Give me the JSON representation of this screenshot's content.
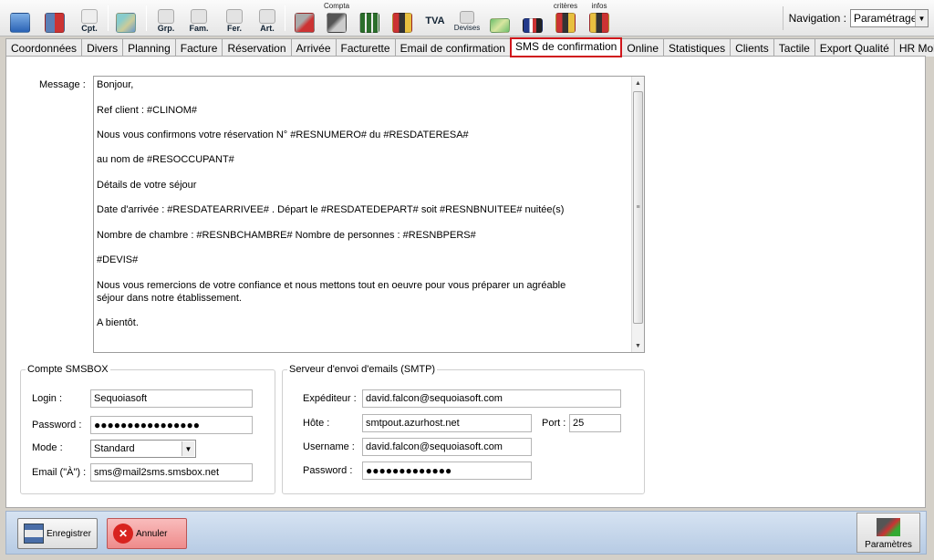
{
  "toolbar": {
    "buttons": [
      {
        "icon": "home-icon",
        "label": "",
        "top": ""
      },
      {
        "icon": "building-icon",
        "label": "",
        "top": ""
      },
      {
        "icon": "accounting-icon",
        "label": "Cpt.",
        "top": ""
      },
      {
        "icon": "cards-icon",
        "label": "",
        "top": ""
      },
      {
        "icon": "group-icon",
        "label": "Grp.",
        "top": ""
      },
      {
        "icon": "family-icon",
        "label": "Fam.",
        "top": ""
      },
      {
        "icon": "closure-icon",
        "label": "Fer.",
        "top": ""
      },
      {
        "icon": "article-icon",
        "label": "Art.",
        "top": ""
      },
      {
        "icon": "tools-icon",
        "label": "",
        "top": ""
      },
      {
        "icon": "accounting-tools-icon",
        "label": "",
        "top": "Compta"
      },
      {
        "icon": "floorplan-icon",
        "label": "",
        "top": ""
      },
      {
        "icon": "people-icon",
        "label": "",
        "top": ""
      },
      {
        "icon": "tax-icon",
        "label": "TVA",
        "top": ""
      },
      {
        "icon": "currency-icon",
        "label": "Devises",
        "top": ""
      },
      {
        "icon": "map-icon",
        "label": "",
        "top": ""
      },
      {
        "icon": "flags-icon",
        "label": "",
        "top": ""
      },
      {
        "icon": "criteria-icon",
        "label": "",
        "top": "critères"
      },
      {
        "icon": "info-icon",
        "label": "",
        "top": "infos"
      }
    ],
    "navigation_label": "Navigation :",
    "navigation_value": "Paramétrage"
  },
  "tabs": [
    "Coordonnées",
    "Divers",
    "Planning",
    "Facture",
    "Réservation",
    "Arrivée",
    "Facturette",
    "Email de confirmation",
    "SMS de confirmation",
    "Online",
    "Statistiques",
    "Clients",
    "Tactile",
    "Export Qualité",
    "HR Mobile"
  ],
  "active_tab": "SMS de confirmation",
  "message": {
    "label": "Message :",
    "lines": [
      "Bonjour,",
      "Ref client :  #CLINOM#",
      "Nous vous confirmons votre réservation N° #RESNUMERO# du #RESDATERESA#",
      "au nom de #RESOCCUPANT#",
      "Détails de votre séjour",
      "Date d'arrivée :  #RESDATEARRIVEE# . Départ le  #RESDATEDEPART# soit  #RESNBNUITEE# nuitée(s)",
      "Nombre de chambre :  #RESNBCHAMBRE#    Nombre de personnes : #RESNBPERS#",
      "#DEVIS#",
      "Nous vous remercions de votre confiance et nous mettons tout en oeuvre pour vous préparer un agréable",
      "séjour dans notre établissement.",
      "A bientôt."
    ]
  },
  "smsbox": {
    "title": "Compte SMSBOX",
    "login_label": "Login :",
    "login_value": "Sequoiasoft",
    "password_label": "Password :",
    "password_value": "●●●●●●●●●●●●●●●●",
    "mode_label": "Mode :",
    "mode_value": "Standard",
    "email_label": "Email (\"À\") :",
    "email_value": "sms@mail2sms.smsbox.net"
  },
  "smtp": {
    "title": "Serveur d'envoi d'emails (SMTP)",
    "sender_label": "Expéditeur :",
    "sender_value": "david.falcon@sequoiasoft.com",
    "host_label": "Hôte :",
    "host_value": "smtpout.azurhost.net",
    "port_label": "Port :",
    "port_value": "25",
    "username_label": "Username :",
    "username_value": "david.falcon@sequoiasoft.com",
    "password_label": "Password :",
    "password_value": "●●●●●●●●●●●●●"
  },
  "actions": {
    "save_label": "Enregistrer",
    "cancel_label": "Annuler",
    "params_label": "Paramètres"
  },
  "colors": {
    "active_tab_border": "#d0161b",
    "cancel_button": "#f5a0a0",
    "bottom_bar": "#c4d5ea"
  }
}
